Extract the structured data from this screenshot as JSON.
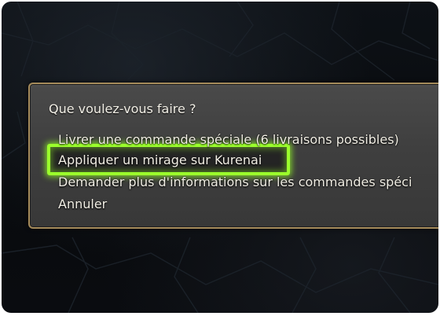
{
  "dialog": {
    "prompt": "Que voulez-vous faire ?",
    "options": [
      {
        "label": "Livrer une commande spéciale (6 livraisons possibles)",
        "selected": false
      },
      {
        "label": "Appliquer un mirage sur Kurenai",
        "selected": true
      },
      {
        "label": "Demander plus d'informations sur les commandes spéci",
        "selected": false
      },
      {
        "label": "Annuler",
        "selected": false
      }
    ]
  },
  "colors": {
    "highlight": "#9bff2c",
    "border": "#a58b5b",
    "panel": "#434343"
  }
}
